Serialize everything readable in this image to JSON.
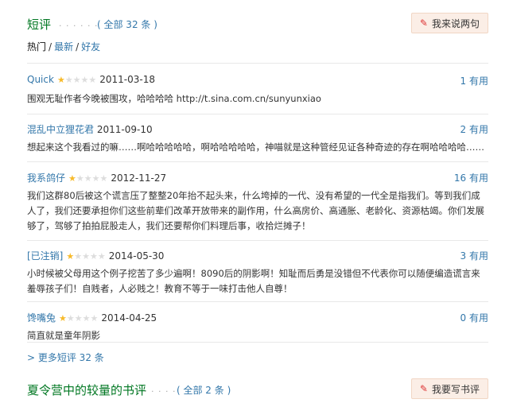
{
  "short_reviews": {
    "title": "短评",
    "dots": "· · · · · ·",
    "count": "( 全部 32 条 )",
    "button": "我来说两句",
    "filters": {
      "hot": "热门",
      "sep": "/",
      "latest": "最新",
      "friends": "好友"
    },
    "comments": [
      {
        "user": "Quick",
        "stars": 1,
        "date": "2011-03-18",
        "votes": "1 有用",
        "text": "围观无耻作者今晚被围攻，哈哈哈哈 http://t.sina.com.cn/sunyunxiao"
      },
      {
        "user": "混乱中立狸花君",
        "stars": 0,
        "date": "2011-09-10",
        "votes": "2 有用",
        "text": "想起来这个我看过的嘛……啊哈哈哈哈哈，啊哈哈哈哈哈，神喵就是这种管经见证各种奇迹的存在啊哈哈哈哈……"
      },
      {
        "user": "我系鸽仔",
        "stars": 1,
        "date": "2012-11-27",
        "votes": "16 有用",
        "text": "我们这群80后被这个谎言压了整整20年抬不起头来，什么垮掉的一代、没有希望的一代全是指我们。等到我们成人了，我们还要承担你们这些前辈们改革开放带来的副作用，什么高房价、高通胀、老龄化、资源枯竭。你们发展够了，驾够了拍拍屁股走人，我们还要帮你们料理后事，收拾烂摊子！"
      },
      {
        "user": "[已注销]",
        "stars": 1,
        "date": "2014-05-30",
        "votes": "3 有用",
        "text": "小时候被父母用这个例子挖苦了多少遍啊！8090后的阴影啊！知耻而后勇是没错但不代表你可以随便编造谎言来羞辱孩子们！自贱者，人必贱之！教育不等于一味打击他人自尊！"
      },
      {
        "user": "馋嘴兔",
        "stars": 1,
        "date": "2014-04-25",
        "votes": "0 有用",
        "text": "简直就是童年阴影"
      }
    ],
    "more": "> 更多短评 32 条"
  },
  "book_reviews": {
    "title": "夏令营中的较量的书评",
    "dots": "· · · · · ·",
    "count": "( 全部 2 条 )",
    "button": "我要写书评"
  },
  "icons": {
    "pencil": "✎",
    "star": "★"
  },
  "colors": {
    "title_green": "#007722",
    "link_blue": "#3377aa",
    "star_gold": "#f7ba2a",
    "button_bg": "#fbeee6"
  }
}
